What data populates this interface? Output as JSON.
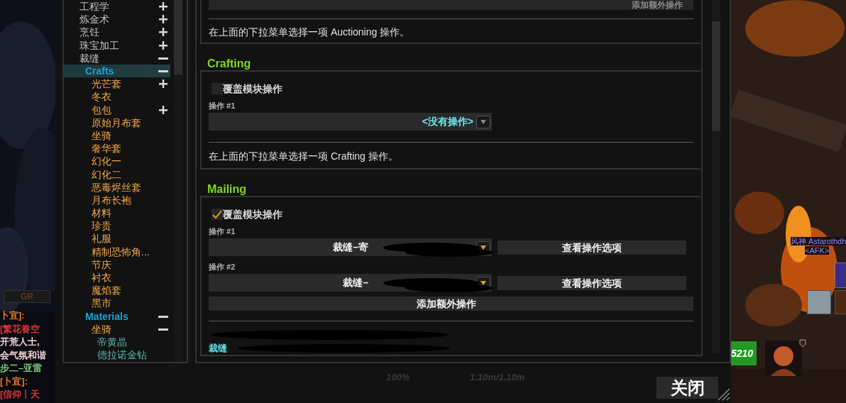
{
  "chat": {
    "tab": "GR",
    "lines": [
      {
        "text": "卜宜]:",
        "color": "#e8782a"
      },
      {
        "text": "[繁花眷空",
        "color": "#d8343a"
      },
      {
        "text": "开荒人士,",
        "color": "#f0d0d0"
      },
      {
        "text": "会气氛和谐",
        "color": "#f0d0d0"
      },
      {
        "text": "步二–亚雷",
        "color": "#7cc87a"
      },
      {
        "text": "[卜宜]:",
        "color": "#e8782a"
      },
      {
        "text": "[信仰丨天",
        "color": "#d8343a"
      }
    ]
  },
  "tree": [
    {
      "label": "工程学",
      "expanded": false
    },
    {
      "label": "炼金术",
      "expanded": false
    },
    {
      "label": "烹饪",
      "expanded": false
    },
    {
      "label": "珠宝加工",
      "expanded": false
    },
    {
      "label": "裁缝",
      "expanded": true,
      "children": [
        {
          "label": "Crafts",
          "expanded": true,
          "selected": true,
          "children": [
            {
              "label": "光芒套",
              "expanded": false
            },
            {
              "label": "冬衣"
            },
            {
              "label": "包包",
              "expanded": false
            },
            {
              "label": "原始月布套"
            },
            {
              "label": "坐骑"
            },
            {
              "label": "奢华套"
            },
            {
              "label": "幻化一"
            },
            {
              "label": "幻化二"
            },
            {
              "label": "恶毒烬丝套"
            },
            {
              "label": "月布长袍"
            },
            {
              "label": "材料"
            },
            {
              "label": "珍贵"
            },
            {
              "label": "礼服"
            },
            {
              "label": "精制恐怖角..."
            },
            {
              "label": "节庆"
            },
            {
              "label": "衬衣"
            },
            {
              "label": "魔焰套"
            },
            {
              "label": "黑市"
            }
          ]
        },
        {
          "label": "Materials",
          "expanded": true,
          "selected": false,
          "children": [
            {
              "label": "坐骑",
              "expanded": true,
              "children": [
                {
                  "label": "帝黄晶"
                },
                {
                  "label": "德拉诺金钻"
                }
              ]
            }
          ]
        }
      ]
    }
  ],
  "top_section": {
    "button": "添加额外操作",
    "note": "在上面的下拉菜单选择一项 Auctioning 操作。"
  },
  "sections": [
    {
      "title": "Crafting",
      "override": {
        "label": "覆盖模块操作",
        "checked": false
      },
      "operations": [
        {
          "label": "操作 #1",
          "value": "<没有操作>",
          "kind": "empty"
        }
      ],
      "note": "在上面的下拉菜单选择一项 Crafting 操作。"
    },
    {
      "title": "Mailing",
      "override": {
        "label": "覆盖模块操作",
        "checked": true
      },
      "operations": [
        {
          "label": "操作 #1",
          "value": "裁缝–寄",
          "kind": "set",
          "options_button": "查看操作选项"
        },
        {
          "label": "操作 #2",
          "value": "裁缝–",
          "kind": "set",
          "options_button": "查看操作选项"
        }
      ],
      "add_button": "添加额外操作",
      "summary": [
        "裁缝"
      ]
    }
  ],
  "footer": {
    "stats": [
      "100%",
      "1.10m/1.10m"
    ],
    "close_button": "关闭"
  },
  "scene": {
    "nameplate": "风神 Astarothdh",
    "status": "<AFK>",
    "health": "5210"
  }
}
